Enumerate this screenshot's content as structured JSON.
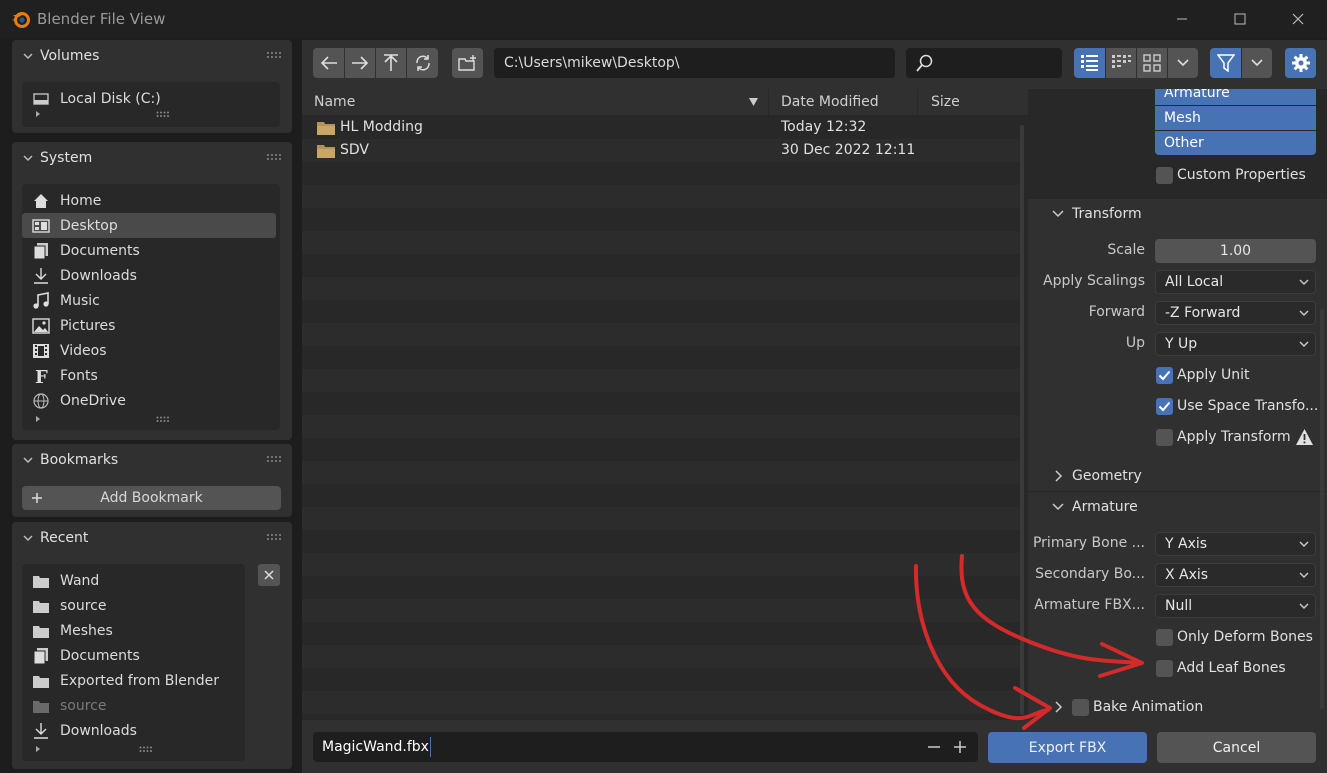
{
  "window": {
    "title": "Blender File View"
  },
  "sidebar": {
    "volumes": {
      "header": "Volumes",
      "items": [
        {
          "label": "Local Disk (C:)",
          "icon": "disk-icon"
        }
      ]
    },
    "system": {
      "header": "System",
      "items": [
        {
          "label": "Home",
          "icon": "home-icon"
        },
        {
          "label": "Desktop",
          "icon": "desktop-icon",
          "active": true
        },
        {
          "label": "Documents",
          "icon": "documents-icon"
        },
        {
          "label": "Downloads",
          "icon": "download-icon"
        },
        {
          "label": "Music",
          "icon": "music-icon"
        },
        {
          "label": "Pictures",
          "icon": "pictures-icon"
        },
        {
          "label": "Videos",
          "icon": "videos-icon"
        },
        {
          "label": "Fonts",
          "icon": "font-icon"
        },
        {
          "label": "OneDrive",
          "icon": "globe-icon"
        }
      ]
    },
    "bookmarks": {
      "header": "Bookmarks",
      "add_label": "Add Bookmark"
    },
    "recent": {
      "header": "Recent",
      "items": [
        {
          "label": "Wand",
          "icon": "folder-icon"
        },
        {
          "label": "source",
          "icon": "folder-icon"
        },
        {
          "label": "Meshes",
          "icon": "folder-icon"
        },
        {
          "label": "Documents",
          "icon": "documents-icon"
        },
        {
          "label": "Exported from Blender",
          "icon": "folder-icon"
        },
        {
          "label": "source",
          "icon": "folder-icon",
          "dim": true
        },
        {
          "label": "Downloads",
          "icon": "download-icon"
        }
      ]
    }
  },
  "toolbar": {
    "path": "C:\\Users\\mikew\\Desktop\\",
    "search_placeholder": ""
  },
  "filelist": {
    "columns": {
      "name": "Name",
      "date": "Date Modified",
      "size": "Size"
    },
    "rows": [
      {
        "name": "HL Modding",
        "date": "Today 12:32"
      },
      {
        "name": "SDV",
        "date": "30 Dec 2022 12:11"
      }
    ]
  },
  "options": {
    "object_types": [
      "Armature",
      "Mesh",
      "Other"
    ],
    "custom_properties": "Custom Properties",
    "transform": {
      "header": "Transform",
      "scale_label": "Scale",
      "scale_value": "1.00",
      "apply_scalings_label": "Apply Scalings",
      "apply_scalings_value": "All Local",
      "forward_label": "Forward",
      "forward_value": "-Z Forward",
      "up_label": "Up",
      "up_value": "Y Up",
      "apply_unit": "Apply Unit",
      "use_space_transform": "Use Space Transfo...",
      "apply_transform": "Apply Transform"
    },
    "geometry": {
      "header": "Geometry"
    },
    "armature": {
      "header": "Armature",
      "primary_label": "Primary Bone ...",
      "primary_value": "Y Axis",
      "secondary_label": "Secondary Bo...",
      "secondary_value": "X Axis",
      "fbx_node_label": "Armature FBX...",
      "fbx_node_value": "Null",
      "only_deform": "Only Deform Bones",
      "add_leaf": "Add Leaf Bones"
    },
    "bake_animation": "Bake Animation"
  },
  "bottom": {
    "filename": "MagicWand.fbx",
    "export_label": "Export FBX",
    "cancel_label": "Cancel"
  },
  "colors": {
    "accent": "#4772b3",
    "annotation": "#d42a2a"
  }
}
